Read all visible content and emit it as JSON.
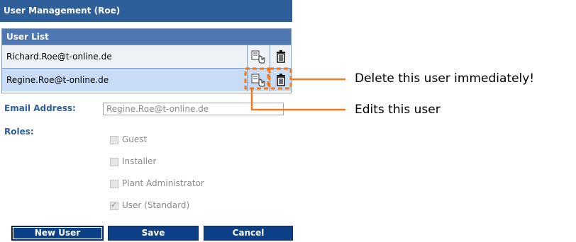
{
  "header": {
    "title": "User Management (Roe)"
  },
  "user_list": {
    "title": "User List",
    "rows": [
      {
        "email": "Richard.Roe@t-online.de"
      },
      {
        "email": "Regine.Roe@t-online.de"
      }
    ]
  },
  "form": {
    "email_label": "Email Address:",
    "email_value": "Regine.Roe@t-online.de",
    "roles_label": "Roles:",
    "roles": [
      {
        "label": "Guest",
        "checked": false
      },
      {
        "label": "Installer",
        "checked": false
      },
      {
        "label": "Plant Administrator",
        "checked": false
      },
      {
        "label": "User (Standard)",
        "checked": true
      }
    ]
  },
  "buttons": {
    "new_user": "New User",
    "save": "Save",
    "cancel": "Cancel"
  },
  "annotations": {
    "delete": "Delete this user immediately!",
    "edit": "Edits this user"
  },
  "colors": {
    "header_bg": "#2f5f9a",
    "list_header_bg": "#4f78b2",
    "selected_row_bg": "#c8dcf7",
    "button_bg": "#0d3f86",
    "callout_orange": "#f07a1e"
  },
  "icons": {
    "edit": "edit-user-icon",
    "delete": "trash-icon"
  }
}
